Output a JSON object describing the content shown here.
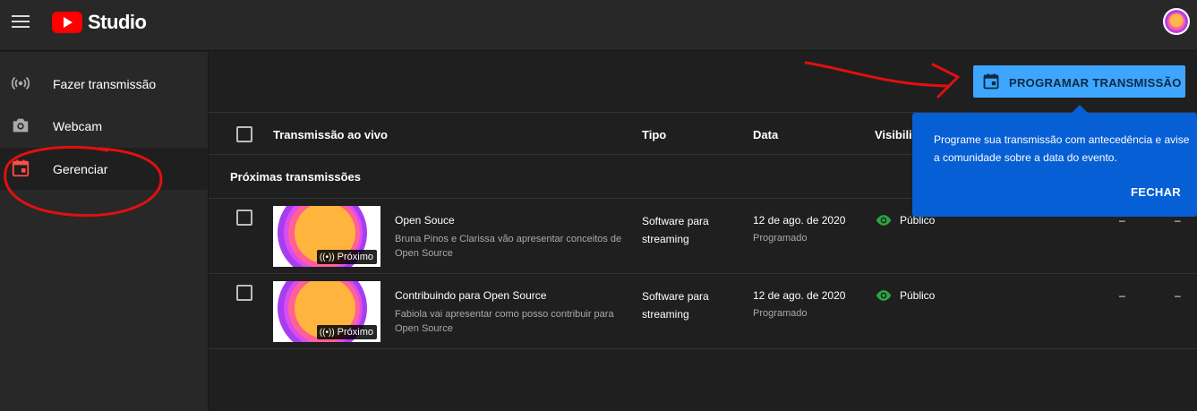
{
  "header": {
    "app_name": "Studio"
  },
  "sidebar": {
    "items": [
      {
        "label": "Fazer transmissão",
        "icon": "broadcast-icon"
      },
      {
        "label": "Webcam",
        "icon": "camera-icon"
      },
      {
        "label": "Gerenciar",
        "icon": "calendar-icon",
        "active": true
      }
    ]
  },
  "toolbar": {
    "schedule_label": "PROGRAMAR TRANSMISSÃO"
  },
  "table": {
    "headers": [
      "Transmissão ao vivo",
      "Tipo",
      "Data",
      "Visibili"
    ],
    "section_title": "Próximas transmissões",
    "rows": [
      {
        "title": "Open Souce",
        "description": "Bruna Pinos e Clarissa vão apresentar conceitos de Open Source",
        "badge": "Próximo",
        "type": "Software para streaming",
        "date": "12 de ago. de 2020",
        "status": "Programado",
        "visibility": "Público",
        "col5": "–",
        "col6": "–"
      },
      {
        "title": "Contribuindo para Open Source",
        "description": "Fabiola vai apresentar como posso contribuir para Open Source",
        "badge": "Próximo",
        "type": "Software para streaming",
        "date": "12 de ago. de 2020",
        "status": "Programado",
        "visibility": "Público",
        "col5": "–",
        "col6": "–"
      }
    ]
  },
  "tooltip": {
    "text": "Programe sua transmissão com antecedência e avise a comunidade sobre a data do evento.",
    "close_label": "FECHAR"
  },
  "colors": {
    "accent": "#3ea6ff",
    "tooltip_bg": "#065fd4",
    "active_icon": "#ff4e45",
    "public_icon": "#2ba640",
    "annotation": "#e01010"
  }
}
